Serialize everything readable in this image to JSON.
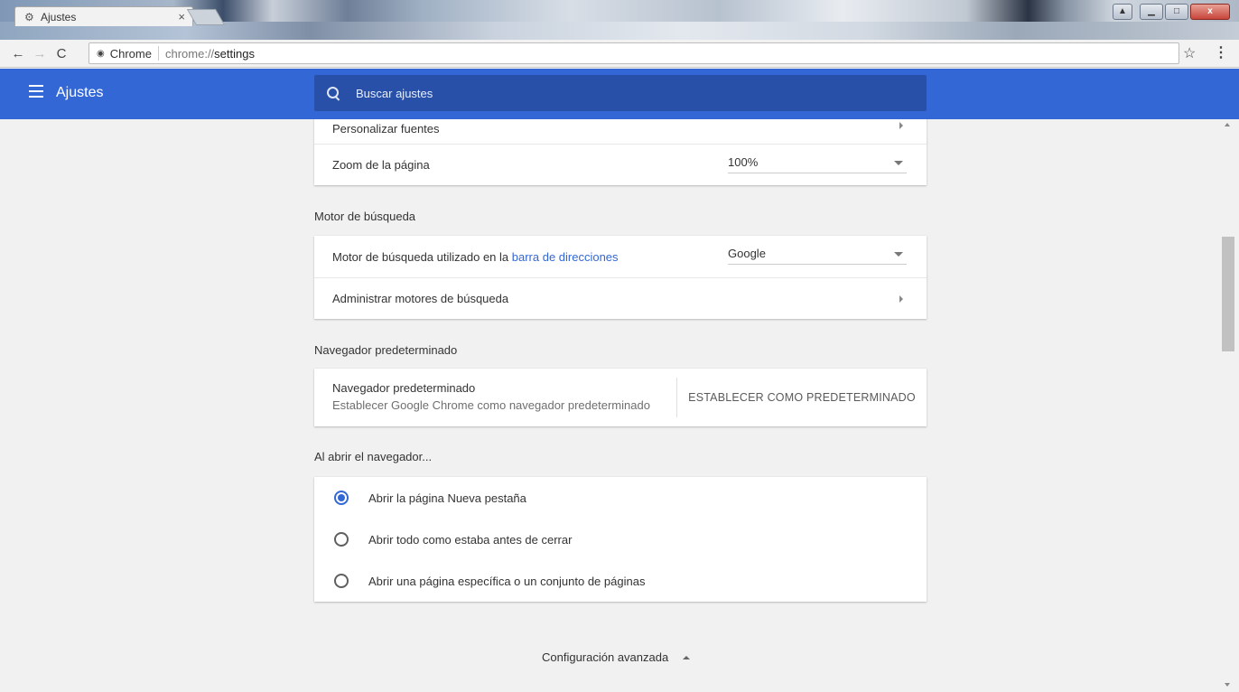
{
  "window": {
    "tab_title": "Ajustes",
    "tab_icon": "gear-icon",
    "tab_close": "×"
  },
  "toolbar": {
    "back": "←",
    "forward": "→",
    "reload": "C",
    "site_name": "Chrome",
    "url_scheme": "chrome://",
    "url_path": "settings",
    "bookmark_star": "☆",
    "menu": "⋮"
  },
  "header": {
    "title": "Ajustes",
    "search_placeholder": "Buscar ajustes"
  },
  "appearance_card": {
    "fonts_label": "Personalizar fuentes",
    "zoom_label": "Zoom de la página",
    "zoom_value": "100%"
  },
  "search_engine": {
    "section_title": "Motor de búsqueda",
    "engine_label_prefix": "Motor de búsqueda utilizado en la ",
    "engine_label_link": "barra de direcciones",
    "engine_value": "Google",
    "manage_label": "Administrar motores de búsqueda"
  },
  "default_browser": {
    "section_title": "Navegador predeterminado",
    "primary": "Navegador predeterminado",
    "secondary": "Establecer Google Chrome como navegador predeterminado",
    "button": "ESTABLECER COMO PREDETERMINADO"
  },
  "on_startup": {
    "section_title": "Al abrir el navegador...",
    "options": [
      {
        "label": "Abrir la página Nueva pestaña",
        "checked": true
      },
      {
        "label": "Abrir todo como estaba antes de cerrar",
        "checked": false
      },
      {
        "label": "Abrir una página específica o un conjunto de páginas",
        "checked": false
      }
    ]
  },
  "advanced": {
    "label": "Configuración avanzada"
  },
  "colors": {
    "header_blue": "#3367d6",
    "search_box": "#2850a8",
    "link_blue": "#3367d6"
  }
}
